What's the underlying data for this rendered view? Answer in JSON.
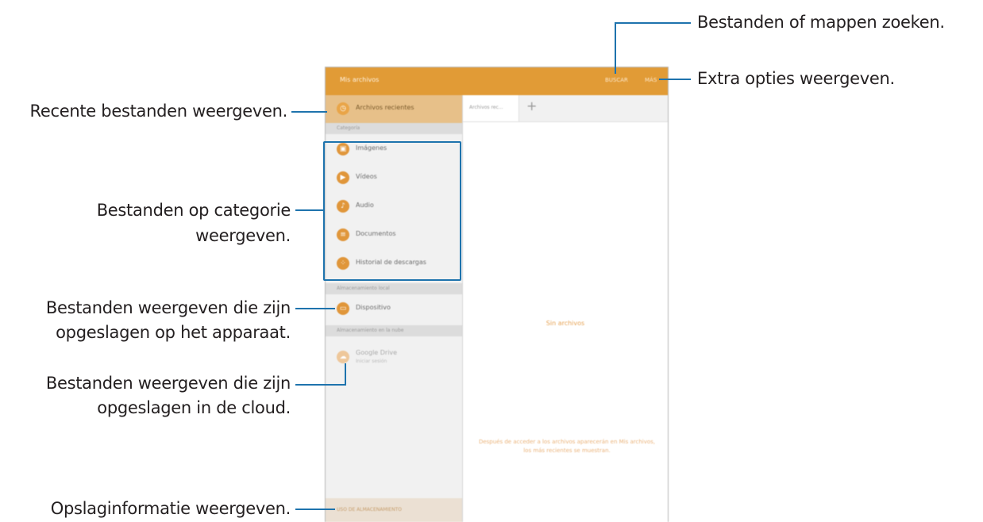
{
  "callouts": {
    "search": "Bestanden of mappen zoeken.",
    "more": "Extra opties weergeven.",
    "recent": "Recente bestanden weergeven.",
    "category_line1": "Bestanden op categorie",
    "category_line2": "weergeven.",
    "device_line1": "Bestanden weergeven die zijn",
    "device_line2": "opgeslagen op het apparaat.",
    "cloud_line1": "Bestanden weergeven die zijn",
    "cloud_line2": "opgeslagen in de cloud.",
    "storage": "Opslaginformatie weergeven."
  },
  "app": {
    "title": "Mis archivos",
    "search_label": "BUSCAR",
    "more_label": "MÁS",
    "recent_label": "Archivos recientes",
    "category_header": "Categoría",
    "categories": [
      {
        "label": "Imágenes",
        "icon": "image-icon"
      },
      {
        "label": "Vídeos",
        "icon": "video-icon"
      },
      {
        "label": "Audio",
        "icon": "music-note-icon"
      },
      {
        "label": "Documentos",
        "icon": "document-icon"
      },
      {
        "label": "Historial de descargas",
        "icon": "download-history-icon"
      }
    ],
    "local_header": "Almacenamiento local",
    "device_label": "Dispositivo",
    "cloud_header": "Almacenamiento en la nube",
    "cloud_label": "Google Drive",
    "cloud_sub": "Iniciar sesión",
    "storage_button": "USO DE ALMACENAMIENTO",
    "tab_label": "Archivos rec...",
    "tab_add": "+",
    "empty_title": "Sin archivos",
    "empty_message": "Después de acceder a los archivos aparecerán en Mis archivos, los más recientes se muestran."
  },
  "colors": {
    "accent": "#e19b36",
    "callout_line": "#1e73ad"
  }
}
